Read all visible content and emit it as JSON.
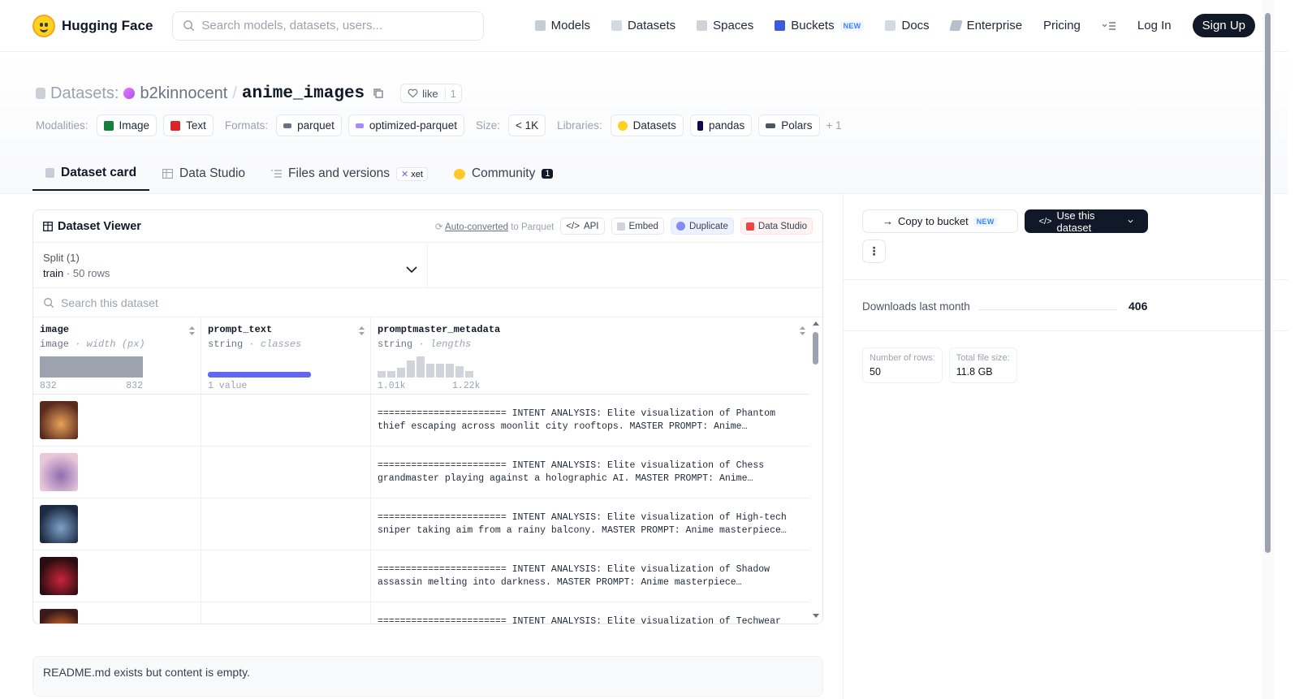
{
  "nav": {
    "brand": "Hugging Face",
    "search_placeholder": "Search models, datasets, users...",
    "links": [
      "Models",
      "Datasets",
      "Spaces",
      "Buckets",
      "Docs",
      "Enterprise",
      "Pricing"
    ],
    "buckets_badge": "NEW",
    "login": "Log In",
    "signup": "Sign Up"
  },
  "header": {
    "prefix": "Datasets:",
    "owner": "b2kinnocent",
    "separator": "/",
    "repo": "anime_images",
    "like_label": "like",
    "like_count": "1"
  },
  "tags": {
    "modalities_label": "Modalities:",
    "modalities": [
      "Image",
      "Text"
    ],
    "formats_label": "Formats:",
    "formats": [
      "parquet",
      "optimized-parquet"
    ],
    "size_label": "Size:",
    "size": "< 1K",
    "libraries_label": "Libraries:",
    "libraries": [
      "Datasets",
      "pandas",
      "Polars"
    ],
    "more": "+ 1"
  },
  "tabs": {
    "card": "Dataset card",
    "studio": "Data Studio",
    "files": "Files and versions",
    "xet": "xet",
    "community": "Community",
    "community_count": "1"
  },
  "viewer": {
    "title": "Dataset Viewer",
    "auto_converted": "Auto-converted",
    "to_parquet": " to Parquet",
    "api": "API",
    "embed": "Embed",
    "duplicate": "Duplicate",
    "data_studio": "Data Studio",
    "split_label": "Split (1)",
    "split_name": "train",
    "split_sep": "·",
    "split_rows": "50 rows",
    "search_placeholder": "Search this dataset",
    "columns": [
      {
        "name": "image",
        "type": "image",
        "stat": "width (px)",
        "min": "832",
        "max": "832"
      },
      {
        "name": "prompt_text",
        "type": "string",
        "stat": "classes",
        "value": "1 value"
      },
      {
        "name": "promptmaster_metadata",
        "type": "string",
        "stat": "lengths",
        "min": "1.01k",
        "max": "1.22k",
        "hist": [
          0.2,
          0.2,
          0.35,
          0.75,
          1.0,
          0.6,
          0.6,
          0.6,
          0.45,
          0.2
        ]
      }
    ],
    "type_sep": " · ",
    "rows": [
      {
        "text": "======================= INTENT ANALYSIS: Elite visualization of Phantom thief escaping across moonlit city rooftops. MASTER PROMPT: Anime…",
        "c1": "#5a2a1e",
        "c2": "#e8a25a"
      },
      {
        "text": "======================= INTENT ANALYSIS: Elite visualization of Chess grandmaster playing against a holographic AI. MASTER PROMPT: Anime…",
        "c1": "#e9c7d8",
        "c2": "#8f6db2"
      },
      {
        "text": "======================= INTENT ANALYSIS: Elite visualization of High-tech sniper taking aim from a rainy balcony. MASTER PROMPT: Anime masterpiece…",
        "c1": "#1c2a44",
        "c2": "#7fa2c8"
      },
      {
        "text": "======================= INTENT ANALYSIS: Elite visualization of Shadow assassin melting into darkness. MASTER PROMPT: Anime masterpiece…",
        "c1": "#2a0d10",
        "c2": "#c9253a"
      },
      {
        "text": "======================= INTENT ANALYSIS: Elite visualization of Techwear",
        "c1": "#3a1a1a",
        "c2": "#f07a2a"
      }
    ]
  },
  "readme": "README.md exists but content is empty.",
  "sidebar": {
    "copy_bucket": "Copy to bucket",
    "copy_badge": "NEW",
    "use_dataset": "Use this dataset",
    "more": "⋮",
    "downloads_label": "Downloads last month",
    "downloads": "406",
    "rows_label": "Number of rows:",
    "rows": "50",
    "size_label": "Total file size:",
    "size": "11.8 GB"
  }
}
